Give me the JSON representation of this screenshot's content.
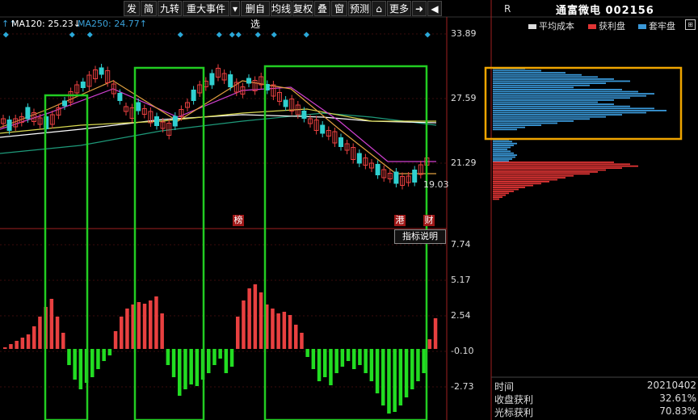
{
  "toolbar": {
    "items": [
      "发",
      "简",
      "九转",
      "重大事件",
      "▾",
      "删自选",
      "均线",
      "复权",
      "叠",
      "窗",
      "预测",
      "⌂",
      "更多",
      "➜",
      "◀"
    ]
  },
  "ma_labels": [
    {
      "text": "MA120: 25.23↓",
      "color": "#ffffff"
    },
    {
      "text": "MA250: 24.77↑",
      "color": "#39a0d8"
    }
  ],
  "price_axis": [
    "33.89",
    "27.59",
    "21.29"
  ],
  "low_marker": "19.03",
  "indicator_axis": [
    "7.74",
    "5.17",
    "2.54",
    "-0.10",
    "-2.73"
  ],
  "event_tags": [
    "榜",
    "港",
    "财"
  ],
  "indicator_button": "指标说明",
  "side": {
    "r_label": "R",
    "title": "通富微电 002156",
    "legend": [
      {
        "text": "平均成本",
        "color": "#dddddd"
      },
      {
        "text": "获利盘",
        "color": "#e03434"
      },
      {
        "text": "套牢盘",
        "color": "#3a98d8"
      }
    ],
    "rows": [
      {
        "label": "时间",
        "value": "20210402"
      },
      {
        "label": "收盘获利",
        "value": "32.61%"
      },
      {
        "label": "光标获利",
        "value": "70.83%"
      }
    ]
  },
  "chart_data": {
    "type": "bar",
    "price_ylim": [
      19.03,
      33.89
    ],
    "indicator_ylim": [
      -2.73,
      7.74
    ],
    "colors": {
      "up": "#e84040",
      "down": "#22dd22",
      "box": "#22cc22",
      "highlight": "#f0a500"
    }
  }
}
